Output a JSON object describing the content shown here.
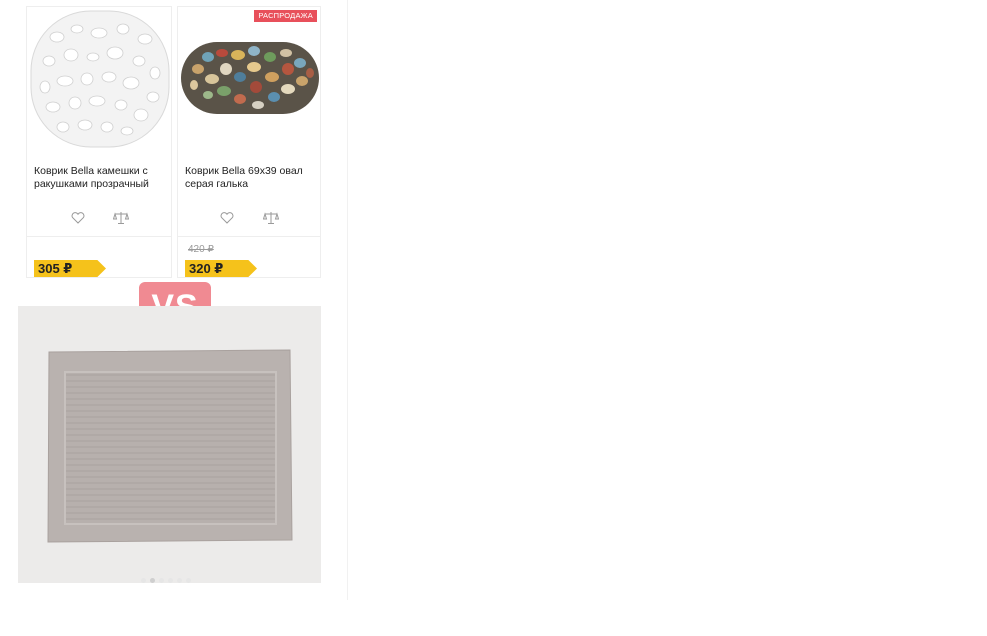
{
  "products": [
    {
      "name": "Коврик Bella камешки с ракушками прозрачный",
      "price": "305 ₽",
      "image": "transparent-pebble-mat-image"
    },
    {
      "badge": "РАСПРОДАЖА",
      "name": "Коврик Bella 69x39 овал серая галька",
      "old_price": "420 ₽",
      "price": "320 ₽",
      "image": "colorful-pebble-mat-image"
    }
  ],
  "icons": {
    "favorite": "heart-icon",
    "compare": "scales-icon"
  },
  "comparison_label": "VS",
  "carousel": {
    "total_dots": 6,
    "active_index": 1
  },
  "colors": {
    "price_tag": "#f5c21b",
    "sale_badge": "#e8505b",
    "vs_badge": "#f08a92"
  }
}
